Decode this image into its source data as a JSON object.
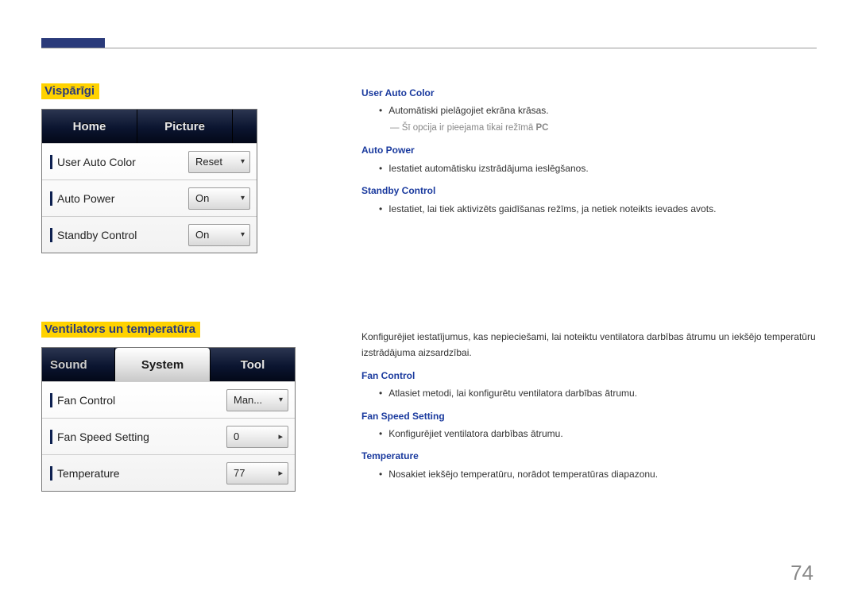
{
  "page_number": "74",
  "section1": {
    "heading": "Vispārīgi",
    "tabs": {
      "home": "Home",
      "picture": "Picture"
    },
    "rows": [
      {
        "label": "User Auto Color",
        "value": "Reset",
        "type": "dropdown"
      },
      {
        "label": "Auto Power",
        "value": "On",
        "type": "dropdown"
      },
      {
        "label": "Standby Control",
        "value": "On",
        "type": "dropdown"
      }
    ],
    "desc": {
      "user_auto_color": {
        "title": "User Auto Color",
        "bullet": "Automātiski pielāgojiet ekrāna krāsas.",
        "note_prefix": "Šī opcija ir pieejama tikai režīmā ",
        "note_bold": "PC"
      },
      "auto_power": {
        "title": "Auto Power",
        "bullet": "Iestatiet automātisku izstrādājuma ieslēgšanos."
      },
      "standby_control": {
        "title": "Standby Control",
        "bullet": "Iestatiet, lai tiek aktivizēts gaidīšanas režīms, ja netiek noteikts ievades avots."
      }
    }
  },
  "section2": {
    "heading": "Ventilators un temperatūra",
    "tabs": {
      "sound": "Sound",
      "system": "System",
      "tool": "Tool"
    },
    "rows": [
      {
        "label": "Fan Control",
        "value": "Man...",
        "type": "dropdown"
      },
      {
        "label": "Fan Speed Setting",
        "value": "0",
        "type": "spinner"
      },
      {
        "label": "Temperature",
        "value": "77",
        "type": "spinner"
      }
    ],
    "intro": "Konfigurējiet iestatījumus, kas nepieciešami, lai noteiktu ventilatora darbības ātrumu un iekšējo temperatūru izstrādājuma aizsardzībai.",
    "desc": {
      "fan_control": {
        "title": "Fan Control",
        "bullet": "Atlasiet metodi, lai konfigurētu ventilatora darbības ātrumu."
      },
      "fan_speed": {
        "title": "Fan Speed Setting",
        "bullet": "Konfigurējiet ventilatora darbības ātrumu."
      },
      "temperature": {
        "title": "Temperature",
        "bullet": "Nosakiet iekšējo temperatūru, norādot temperatūras diapazonu."
      }
    }
  }
}
